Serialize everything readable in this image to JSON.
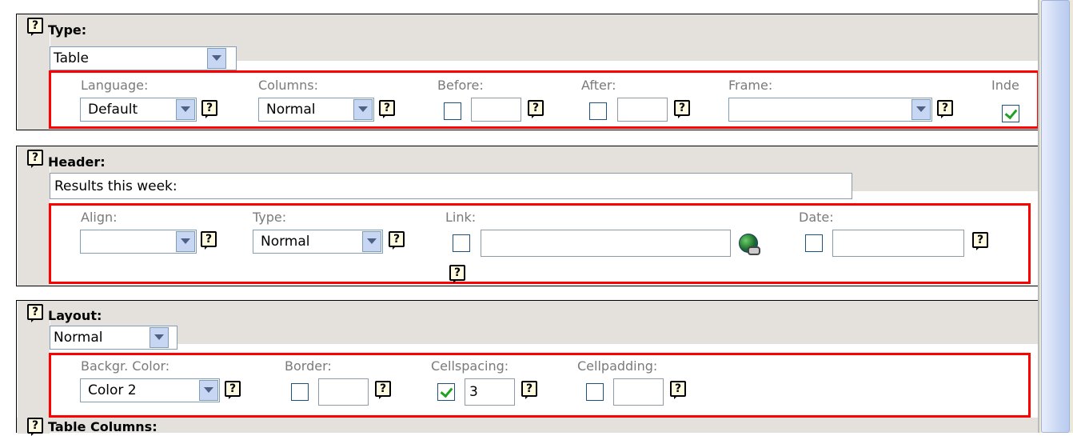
{
  "sections": {
    "type": {
      "title": "Type:",
      "select_value": "Table",
      "fields": {
        "language": {
          "label": "Language:",
          "value": "Default"
        },
        "columns": {
          "label": "Columns:",
          "value": "Normal"
        },
        "before": {
          "label": "Before:",
          "checked": false,
          "value": ""
        },
        "after": {
          "label": "After:",
          "checked": false,
          "value": ""
        },
        "frame": {
          "label": "Frame:",
          "value": ""
        },
        "indent": {
          "label": "Inde",
          "checked": true
        }
      }
    },
    "header": {
      "title": "Header:",
      "text_value": "Results this week:",
      "fields": {
        "align": {
          "label": "Align:",
          "value": ""
        },
        "type": {
          "label": "Type:",
          "value": "Normal"
        },
        "link": {
          "label": "Link:",
          "checked": false,
          "value": ""
        },
        "date": {
          "label": "Date:",
          "checked": false,
          "value": ""
        }
      }
    },
    "layout": {
      "title": "Layout:",
      "select_value": "Normal",
      "fields": {
        "bgcolor": {
          "label": "Backgr. Color:",
          "value": "Color 2"
        },
        "border": {
          "label": "Border:",
          "checked": false,
          "value": ""
        },
        "cellspacing": {
          "label": "Cellspacing:",
          "checked": true,
          "value": "3"
        },
        "cellpadding": {
          "label": "Cellpadding:",
          "checked": false,
          "value": ""
        }
      }
    },
    "table_columns": {
      "title": "Table Columns:"
    }
  },
  "help_glyph": "?",
  "colors": {
    "highlight_border": "#ff0000",
    "section_bar": "#e4e1dc"
  }
}
